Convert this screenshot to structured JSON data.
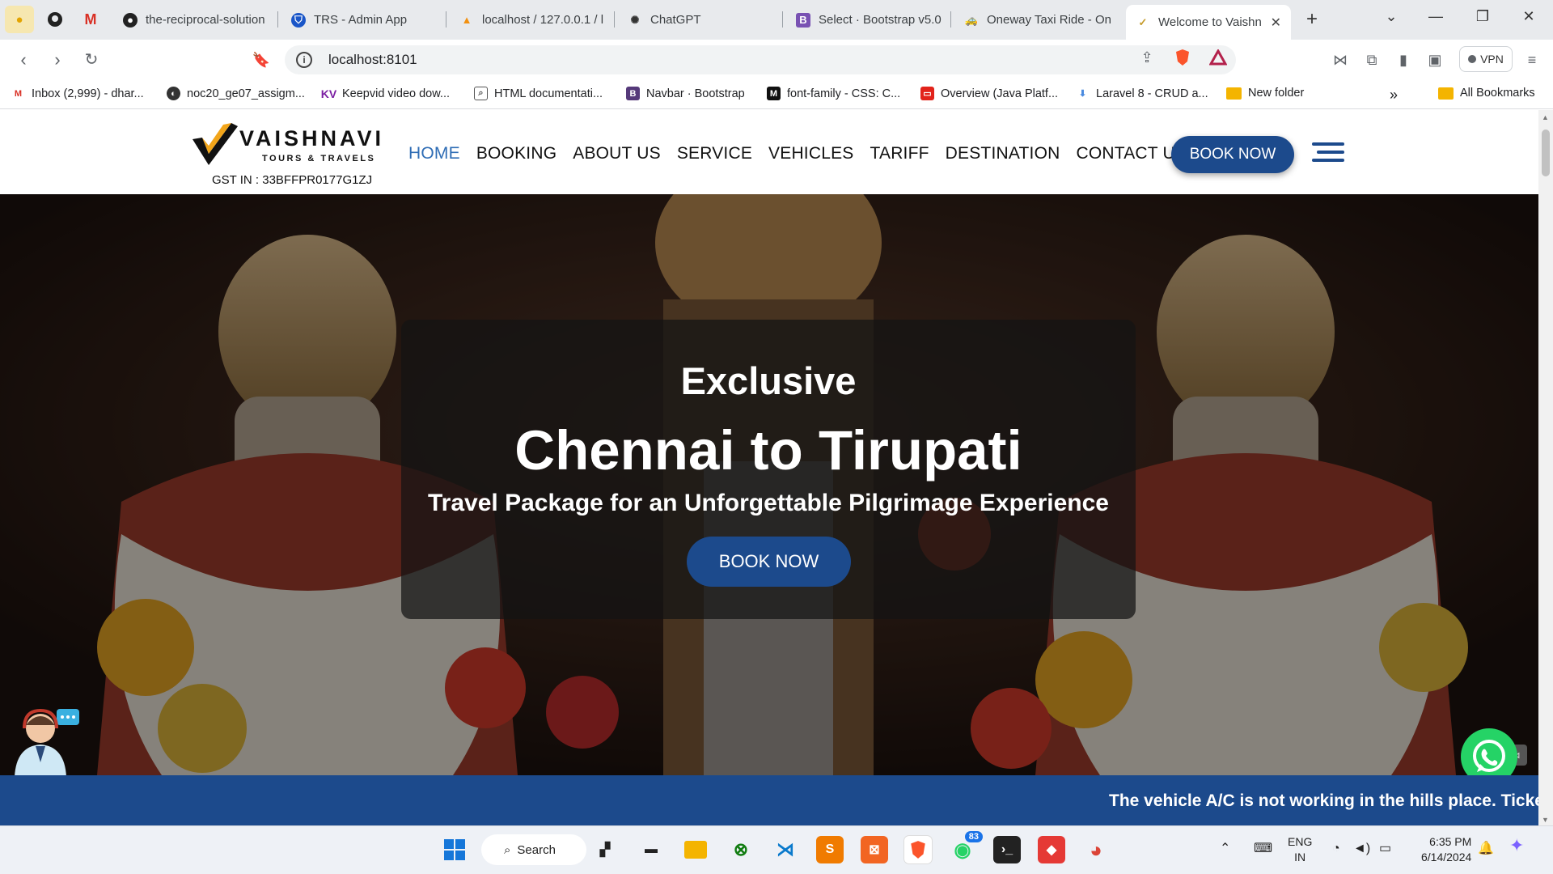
{
  "browser": {
    "tabs": [
      {
        "label": "the-reciprocal-solution",
        "icon": "github-icon"
      },
      {
        "label": "TRS - Admin App",
        "icon": "shield-icon"
      },
      {
        "label": "localhost / 127.0.0.1 / l",
        "icon": "phpmyadmin-icon"
      },
      {
        "label": "ChatGPT",
        "icon": "chatgpt-icon"
      },
      {
        "label": "Select · Bootstrap v5.0",
        "icon": "bootstrap-icon"
      },
      {
        "label": "Oneway Taxi Ride - On",
        "icon": "car-icon"
      },
      {
        "label": "Welcome to Vaishn",
        "icon": "site-icon",
        "active": true
      }
    ],
    "url": "localhost:8101",
    "vpn_label": "VPN",
    "bookmarks": [
      {
        "label": "Inbox (2,999) - dhar...",
        "icon": "gmail-icon"
      },
      {
        "label": "noc20_ge07_assigm...",
        "icon": "globe-icon"
      },
      {
        "label": "Keepvid video dow...",
        "icon": "kv-icon"
      },
      {
        "label": "HTML documentati...",
        "icon": "doc-icon"
      },
      {
        "label": "Navbar · Bootstrap",
        "icon": "bootstrap-icon"
      },
      {
        "label": "font-family - CSS: C...",
        "icon": "mdn-icon"
      },
      {
        "label": "Overview (Java Platf...",
        "icon": "oracle-icon"
      },
      {
        "label": "Laravel 8 - CRUD a...",
        "icon": "laravel-icon"
      },
      {
        "label": "New folder",
        "icon": "folder-icon"
      }
    ],
    "all_bookmarks": "All Bookmarks"
  },
  "site": {
    "brand": "VAISHNAVI",
    "brand_sub": "TOURS & TRAVELS",
    "gst": "GST IN : 33BFFPR0177G1ZJ",
    "menu": [
      "HOME",
      "BOOKING",
      "ABOUT US",
      "SERVICE",
      "VEHICLES",
      "TARIFF",
      "DESTINATION",
      "CONTACT US"
    ],
    "nav_book": "BOOK NOW",
    "hero": {
      "line1": "Exclusive",
      "line2": "Chennai to Tirupati",
      "line3": "Travel Package for an Unforgettable Pilgrimage Experience",
      "button": "BOOK NOW"
    },
    "ticker": "The vehicle A/C is not working in the hills place. Tickets are"
  },
  "taskbar": {
    "search": "Search",
    "whatsapp_badge": "83",
    "lang1": "ENG",
    "lang2": "IN",
    "time": "6:35 PM",
    "date": "6/14/2024"
  },
  "colors": {
    "brand_blue": "#1c4a8c",
    "active_menu": "#2f6db5",
    "whatsapp": "#25d366"
  }
}
